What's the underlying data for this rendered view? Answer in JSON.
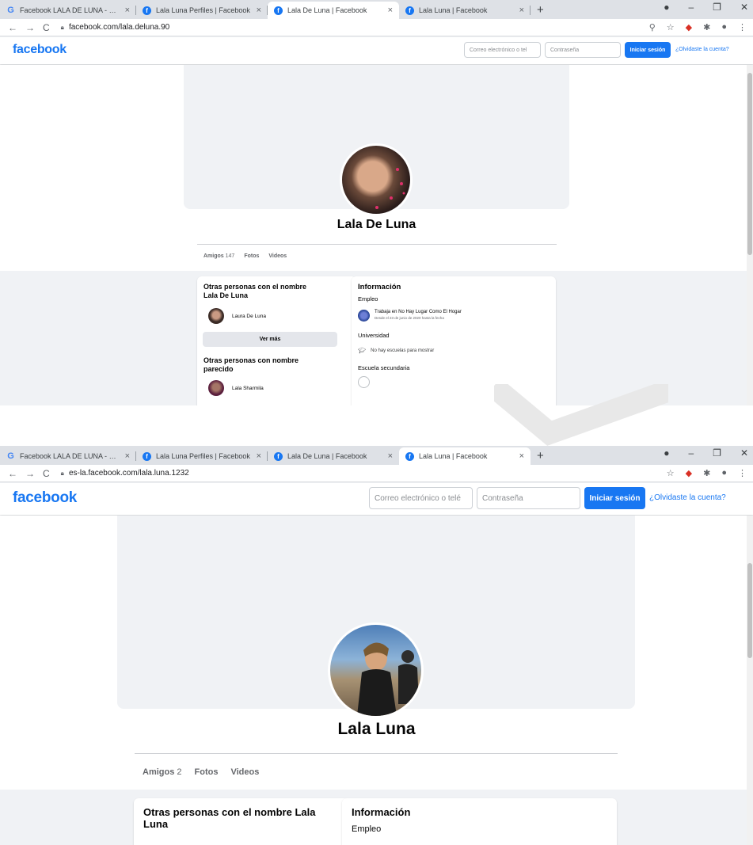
{
  "shot1": {
    "tabs": [
      {
        "icon": "google-icon",
        "label": "Facebook LALA DE LUNA - Busca",
        "active": false
      },
      {
        "icon": "facebook-icon",
        "label": "Lala Luna Perfiles | Facebook",
        "active": false
      },
      {
        "icon": "facebook-icon",
        "label": "Lala De Luna | Facebook",
        "active": true
      },
      {
        "icon": "facebook-icon",
        "label": "Lala Luna | Facebook",
        "active": false
      }
    ],
    "url": "facebook.com/lala.deluna.90",
    "fb": {
      "logo": "facebook",
      "email_placeholder": "Correo electrónico o tel",
      "password_placeholder": "Contraseña",
      "login_label": "Iniciar sesión",
      "forgot_label": "¿Olvidaste la cuenta?"
    },
    "profile": {
      "name": "Lala De Luna",
      "friends_label": "Amigos",
      "friends_count": "147",
      "photos_label": "Fotos",
      "videos_label": "Videos"
    },
    "left_card": {
      "title": "Otras personas con el nombre Lala De Luna",
      "person1": "Laura De Luna",
      "more_label": "Ver más",
      "similar_title": "Otras personas con nombre parecido",
      "person2": "Lala Sharmila"
    },
    "info_card": {
      "title": "Información",
      "employment_label": "Empleo",
      "job": "Trabaja en No Hay Lugar Como El Hogar",
      "job_date": "Desde el 23 de junio de 2020 hasta la fecha",
      "university_label": "Universidad",
      "no_schools": "No hay escuelas para mostrar",
      "highschool_label": "Escuela secundaria"
    }
  },
  "shot2": {
    "tabs": [
      {
        "icon": "google-icon",
        "label": "Facebook LALA DE LUNA - Busca",
        "active": false
      },
      {
        "icon": "facebook-icon",
        "label": "Lala Luna Perfiles | Facebook",
        "active": false
      },
      {
        "icon": "facebook-icon",
        "label": "Lala De Luna | Facebook",
        "active": false
      },
      {
        "icon": "facebook-icon",
        "label": "Lala Luna | Facebook",
        "active": true
      }
    ],
    "url": "es-la.facebook.com/lala.luna.1232",
    "fb": {
      "logo": "facebook",
      "email_placeholder": "Correo electrónico o telé",
      "password_placeholder": "Contraseña",
      "login_label": "Iniciar sesión",
      "forgot_label": "¿Olvidaste la cuenta?"
    },
    "profile": {
      "name": "Lala Luna",
      "friends_label": "Amigos",
      "friends_count": "2",
      "photos_label": "Fotos",
      "videos_label": "Videos"
    },
    "left_card": {
      "title": "Otras personas con el nombre Lala Luna"
    },
    "info_card": {
      "title": "Información",
      "employment_label": "Empleo"
    }
  },
  "colors": {
    "facebook_blue": "#1877f2",
    "page_bg": "#f0f2f5",
    "tabbar_bg": "#dee1e6"
  }
}
